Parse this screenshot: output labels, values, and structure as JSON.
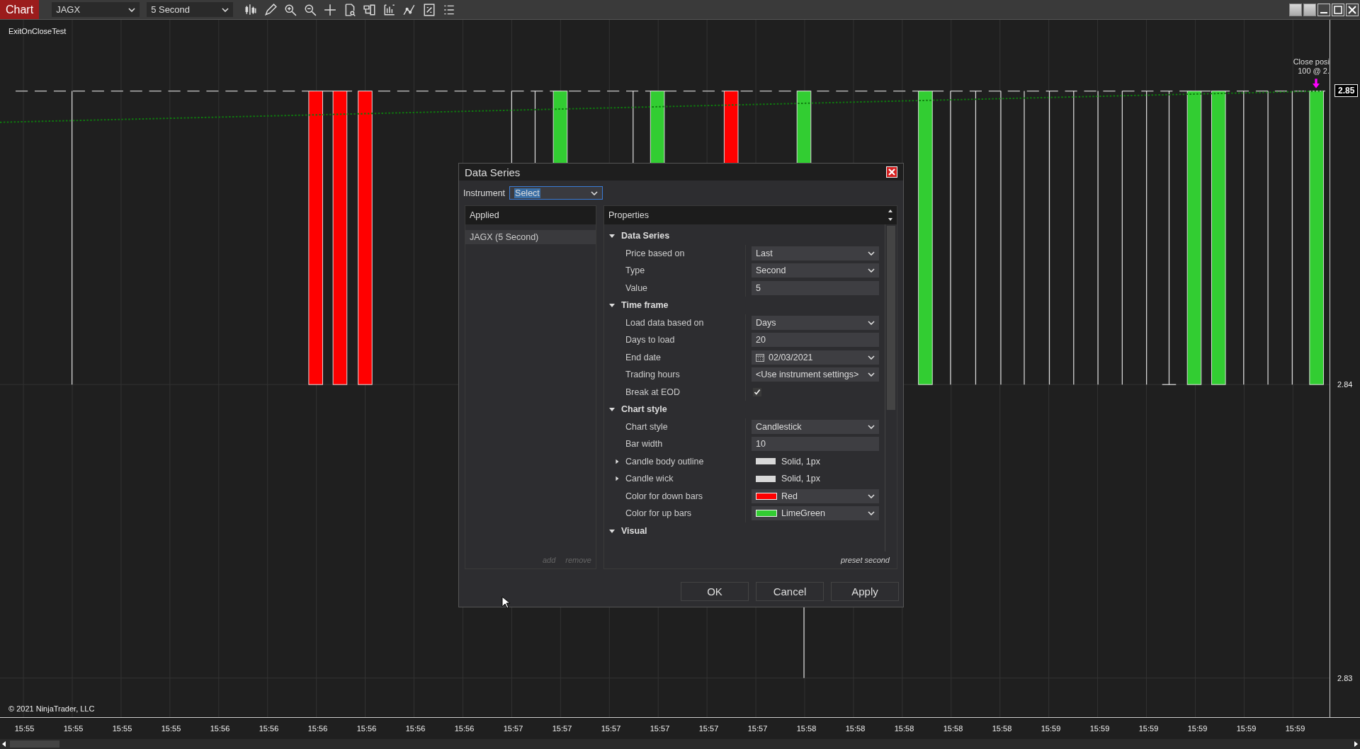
{
  "toolbar": {
    "chart_button": "Chart",
    "instrument": "JAGX",
    "interval": "5 Second"
  },
  "chart": {
    "indicator_label": "ExitOnCloseTest",
    "annotation": [
      "Close posi",
      "100 @ 2."
    ],
    "current_price": "2.85",
    "price_labels": [
      "2.84",
      "2.83"
    ],
    "copyright": "© 2021 NinjaTrader, LLC",
    "time_labels": [
      "15:55",
      "15:55",
      "15:55",
      "15:55",
      "15:56",
      "15:56",
      "15:56",
      "15:56",
      "15:56",
      "15:56",
      "15:57",
      "15:57",
      "15:57",
      "15:57",
      "15:57",
      "15:57",
      "15:58",
      "15:58",
      "15:58",
      "15:58",
      "15:58",
      "15:59",
      "15:59",
      "15:59",
      "15:59",
      "15:59",
      "15:59"
    ]
  },
  "dialog": {
    "title": "Data Series",
    "instrument_label": "Instrument",
    "instrument_value": "Select",
    "applied": {
      "header": "Applied",
      "items": [
        {
          "label": "JAGX (5 Second)",
          "selected": true
        }
      ],
      "add": "add",
      "remove": "remove",
      "actions_disabled": true
    },
    "properties": {
      "header": "Properties",
      "preset": "preset second",
      "categories": [
        {
          "name": "Data Series",
          "expanded": true,
          "rows": [
            {
              "label": "Price based on",
              "kind": "dropdown",
              "value": "Last"
            },
            {
              "label": "Type",
              "kind": "dropdown",
              "value": "Second"
            },
            {
              "label": "Value",
              "kind": "text",
              "value": "5"
            }
          ]
        },
        {
          "name": "Time frame",
          "expanded": true,
          "rows": [
            {
              "label": "Load data based on",
              "kind": "dropdown",
              "value": "Days"
            },
            {
              "label": "Days to load",
              "kind": "text",
              "value": "20"
            },
            {
              "label": "End date",
              "kind": "date",
              "value": "02/03/2021"
            },
            {
              "label": "Trading hours",
              "kind": "dropdown",
              "value": "<Use instrument settings>"
            },
            {
              "label": "Break at EOD",
              "kind": "checkbox",
              "checked": true
            }
          ]
        },
        {
          "name": "Chart style",
          "expanded": true,
          "rows": [
            {
              "label": "Chart style",
              "kind": "dropdown",
              "value": "Candlestick"
            },
            {
              "label": "Bar width",
              "kind": "text",
              "value": "10"
            },
            {
              "label": "Candle body outline",
              "kind": "stroke",
              "value": "Solid, 1px",
              "expanded": false,
              "color": "#d8d8d8"
            },
            {
              "label": "Candle wick",
              "kind": "stroke",
              "value": "Solid, 1px",
              "expanded": false,
              "color": "#d8d8d8"
            },
            {
              "label": "Color for down bars",
              "kind": "color",
              "value": "Red",
              "color": "#ff0000"
            },
            {
              "label": "Color for up bars",
              "kind": "color",
              "value": "LimeGreen",
              "color": "#32cd32"
            }
          ]
        },
        {
          "name": "Visual",
          "expanded": true
        }
      ]
    },
    "buttons": [
      "OK",
      "Cancel",
      "Apply"
    ]
  }
}
